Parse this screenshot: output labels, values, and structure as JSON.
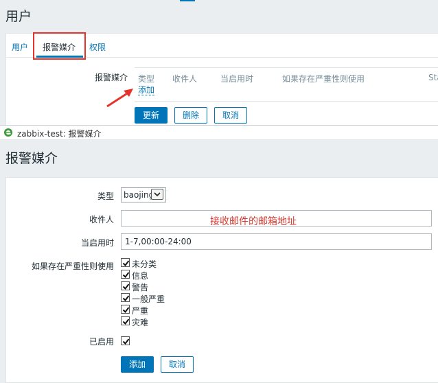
{
  "user_form": {
    "page_title": "用户",
    "tabs": [
      {
        "label": "用户"
      },
      {
        "label": "报警媒介"
      },
      {
        "label": "权限"
      }
    ],
    "media_label": "报警媒介",
    "table_headers": [
      "类型",
      "收件人",
      "当启用时",
      "如果存在严重性则使用",
      "Sta"
    ],
    "add_link": "添加",
    "buttons": {
      "update": "更新",
      "delete": "删除",
      "cancel": "取消"
    },
    "highlight_color": "#e5322b",
    "accent_color": "#0275b8"
  },
  "media_popup": {
    "window_title": "zabbix-test: 报警媒介",
    "page_title": "报警媒介",
    "type_label": "类型",
    "type_value": "baojing",
    "recipient_label": "收件人",
    "recipient_value": "",
    "recipient_annotation": "接收邮件的邮箱地址",
    "when_active_label": "当启用时",
    "when_active_value": "1-7,00:00-24:00",
    "severity_label": "如果存在严重性则使用",
    "severities": [
      {
        "label": "未分类",
        "checked": true
      },
      {
        "label": "信息",
        "checked": true
      },
      {
        "label": "警告",
        "checked": true
      },
      {
        "label": "一般严重",
        "checked": true
      },
      {
        "label": "严重",
        "checked": true
      },
      {
        "label": "灾难",
        "checked": true
      }
    ],
    "enabled_label": "已启用",
    "enabled_checked": true,
    "buttons": {
      "add": "添加",
      "cancel": "取消"
    }
  }
}
